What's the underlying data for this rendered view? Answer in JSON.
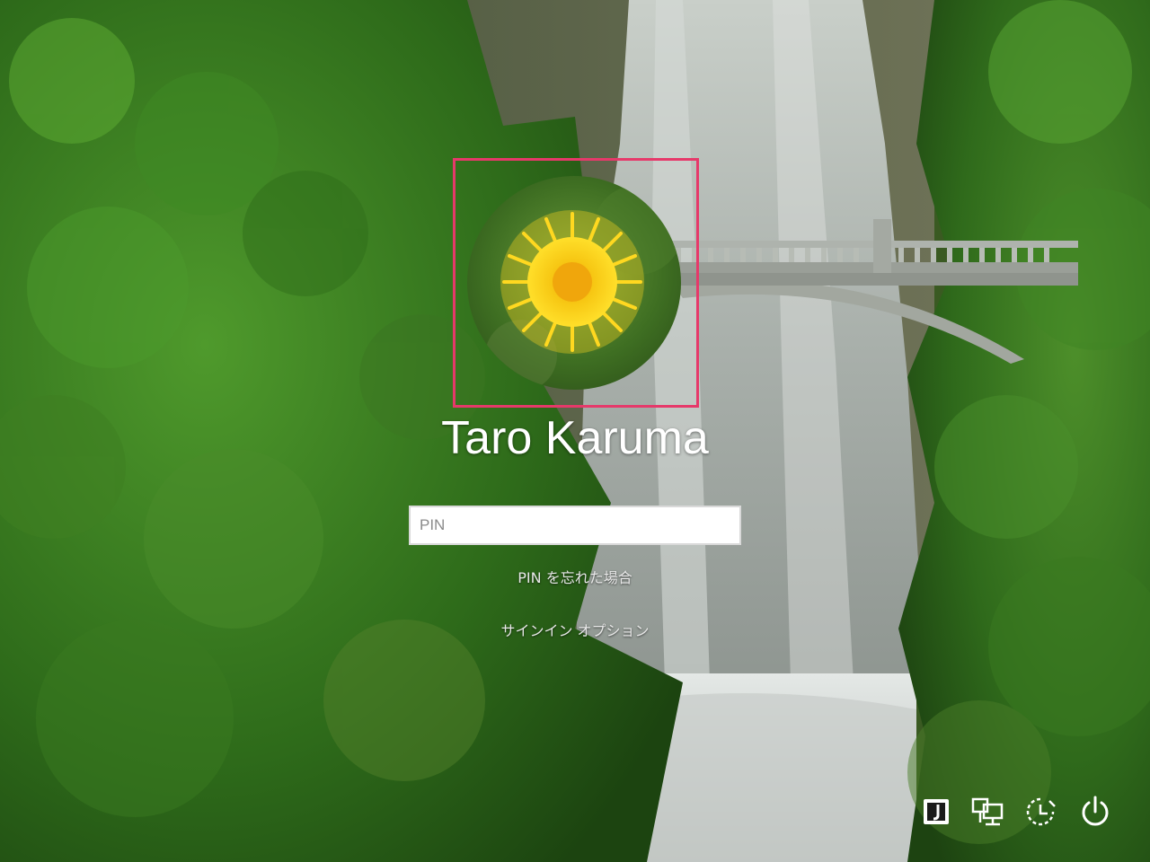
{
  "user": {
    "name": "Taro Karuma"
  },
  "pin": {
    "placeholder": "PIN",
    "value": ""
  },
  "links": {
    "forgot_pin": "PIN を忘れた場合",
    "signin_options": "サインイン オプション"
  },
  "system_icons": [
    {
      "name": "ime-mode-icon"
    },
    {
      "name": "network-icon"
    },
    {
      "name": "ease-of-access-icon"
    },
    {
      "name": "power-icon"
    }
  ],
  "colors": {
    "highlight_frame": "#e6396a",
    "text": "#ffffff",
    "link_text": "#e8e8e8"
  }
}
